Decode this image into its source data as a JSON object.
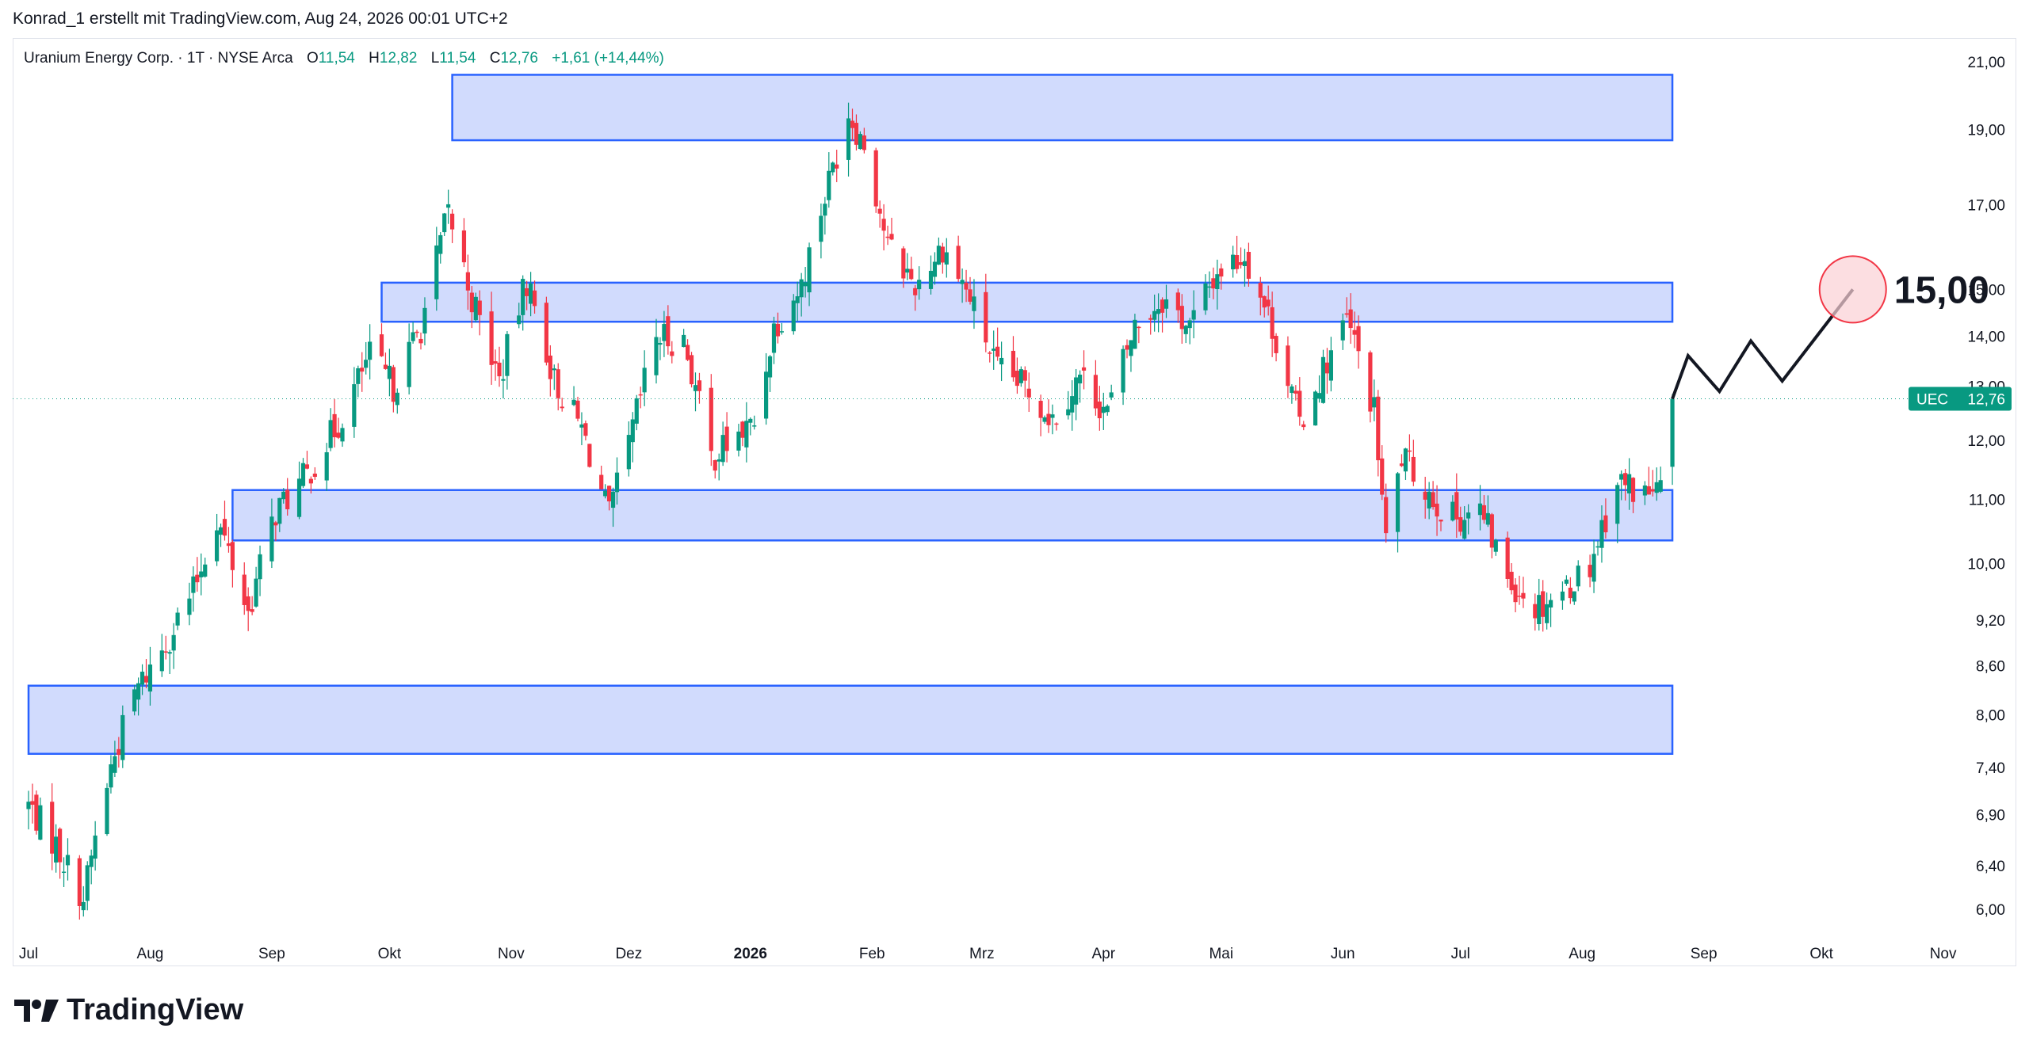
{
  "header": {
    "credit": "Konrad_1 erstellt mit TradingView.com, Aug 24, 2026 00:01 UTC+2"
  },
  "legend": {
    "symbol": "Uranium Energy Corp. · 1T · NYSE Arca",
    "o_label": "O",
    "o_value": "11,54",
    "h_label": "H",
    "h_value": "12,82",
    "l_label": "L",
    "l_value": "11,54",
    "c_label": "C",
    "c_value": "12,76",
    "change": "+1,61 (+14,44%)"
  },
  "price_tag": {
    "ticker": "UEC",
    "price": "12,76"
  },
  "annotation": {
    "target": "15,00"
  },
  "brand": {
    "name": "TradingView"
  },
  "colors": {
    "up": "#089981",
    "down": "#f23645",
    "zone_fill": "#d1dbfd",
    "zone_border": "#2962ff",
    "text": "#131722",
    "axis_text": "#131722",
    "circle_stroke": "#f23645",
    "circle_fill": "#fbd0d4"
  },
  "chart_data": {
    "type": "candlestick",
    "scale": "log",
    "y_ticks": [
      6.0,
      6.4,
      6.9,
      7.4,
      8.0,
      8.6,
      9.2,
      10.0,
      11.0,
      12.0,
      13.0,
      14.0,
      15.0,
      17.0,
      19.0,
      21.0
    ],
    "y_tick_labels": [
      "6,00",
      "6,40",
      "6,90",
      "7,40",
      "8,00",
      "8,60",
      "9,20",
      "10,00",
      "11,00",
      "12,00",
      "13,00",
      "14,00",
      "15,00",
      "17,00",
      "19,00",
      "21,00"
    ],
    "x_labels": [
      "Jul",
      "Aug",
      "Sep",
      "Okt",
      "Nov",
      "Dez",
      "2026",
      "Feb",
      "Mrz",
      "Apr",
      "Mai",
      "Jun",
      "Jul",
      "Aug",
      "Sep",
      "Okt",
      "Nov"
    ],
    "last_price": 12.76,
    "zones": [
      {
        "low": 18.7,
        "high": 20.6,
        "from": "2025-10-17",
        "to": "2026-08-24"
      },
      {
        "low": 14.3,
        "high": 15.15,
        "from": "2025-09-29",
        "to": "2026-08-24"
      },
      {
        "low": 10.35,
        "high": 11.15,
        "from": "2025-08-22",
        "to": "2026-08-24"
      },
      {
        "low": 7.55,
        "high": 8.35,
        "from": "2025-07-01",
        "to": "2026-08-24"
      }
    ],
    "projection": [
      {
        "date": "2026-08-24",
        "price": 12.76
      },
      {
        "date": "2026-08-28",
        "price": 13.6
      },
      {
        "date": "2026-09-05",
        "price": 12.9
      },
      {
        "date": "2026-09-13",
        "price": 13.9
      },
      {
        "date": "2026-09-21",
        "price": 13.1
      },
      {
        "date": "2026-10-09",
        "price": 15.0
      }
    ],
    "target": 15.0,
    "waypoints": [
      [
        "2025-07-01",
        7.0
      ],
      [
        "2025-07-08",
        6.6
      ],
      [
        "2025-07-15",
        6.1
      ],
      [
        "2025-07-22",
        7.4
      ],
      [
        "2025-07-28",
        8.25
      ],
      [
        "2025-08-05",
        8.9
      ],
      [
        "2025-08-12",
        9.6
      ],
      [
        "2025-08-18",
        10.7
      ],
      [
        "2025-08-22",
        10.0
      ],
      [
        "2025-08-26",
        9.3
      ],
      [
        "2025-09-02",
        10.8
      ],
      [
        "2025-09-10",
        11.4
      ],
      [
        "2025-09-18",
        12.3
      ],
      [
        "2025-09-26",
        13.6
      ],
      [
        "2025-10-02",
        13.0
      ],
      [
        "2025-10-09",
        14.2
      ],
      [
        "2025-10-16",
        16.8
      ],
      [
        "2025-10-22",
        14.8
      ],
      [
        "2025-10-29",
        13.1
      ],
      [
        "2025-11-05",
        15.2
      ],
      [
        "2025-11-12",
        13.1
      ],
      [
        "2025-11-19",
        12.2
      ],
      [
        "2025-11-26",
        10.7
      ],
      [
        "2025-12-01",
        11.9
      ],
      [
        "2025-12-08",
        14.0
      ],
      [
        "2025-12-15",
        13.9
      ],
      [
        "2025-12-22",
        11.7
      ],
      [
        "2026-01-02",
        12.3
      ],
      [
        "2026-01-07",
        14.2
      ],
      [
        "2026-01-14",
        15.1
      ],
      [
        "2026-01-21",
        17.6
      ],
      [
        "2026-01-26",
        19.5
      ],
      [
        "2026-01-30",
        18.6
      ],
      [
        "2026-02-05",
        16.0
      ],
      [
        "2026-02-12",
        15.1
      ],
      [
        "2026-02-19",
        16.0
      ],
      [
        "2026-02-26",
        14.8
      ],
      [
        "2026-03-05",
        13.3
      ],
      [
        "2026-03-12",
        13.0
      ],
      [
        "2026-03-19",
        12.4
      ],
      [
        "2026-03-26",
        13.2
      ],
      [
        "2026-04-02",
        12.5
      ],
      [
        "2026-04-09",
        14.2
      ],
      [
        "2026-04-16",
        14.8
      ],
      [
        "2026-04-23",
        14.2
      ],
      [
        "2026-04-30",
        15.4
      ],
      [
        "2026-05-07",
        15.8
      ],
      [
        "2026-05-14",
        14.2
      ],
      [
        "2026-05-21",
        12.3
      ],
      [
        "2026-05-28",
        13.5
      ],
      [
        "2026-06-02",
        14.3
      ],
      [
        "2026-06-05",
        13.6
      ],
      [
        "2026-06-09",
        12.5
      ],
      [
        "2026-06-12",
        10.3
      ],
      [
        "2026-06-16",
        11.7
      ],
      [
        "2026-06-22",
        11.2
      ],
      [
        "2026-06-28",
        10.7
      ],
      [
        "2026-07-06",
        10.8
      ],
      [
        "2026-07-13",
        9.8
      ],
      [
        "2026-07-20",
        9.4
      ],
      [
        "2026-07-27",
        9.6
      ],
      [
        "2026-08-03",
        10.0
      ],
      [
        "2026-08-10",
        11.3
      ],
      [
        "2026-08-17",
        11.1
      ],
      [
        "2026-08-21",
        11.15
      ],
      [
        "2026-08-24",
        12.76
      ]
    ]
  }
}
